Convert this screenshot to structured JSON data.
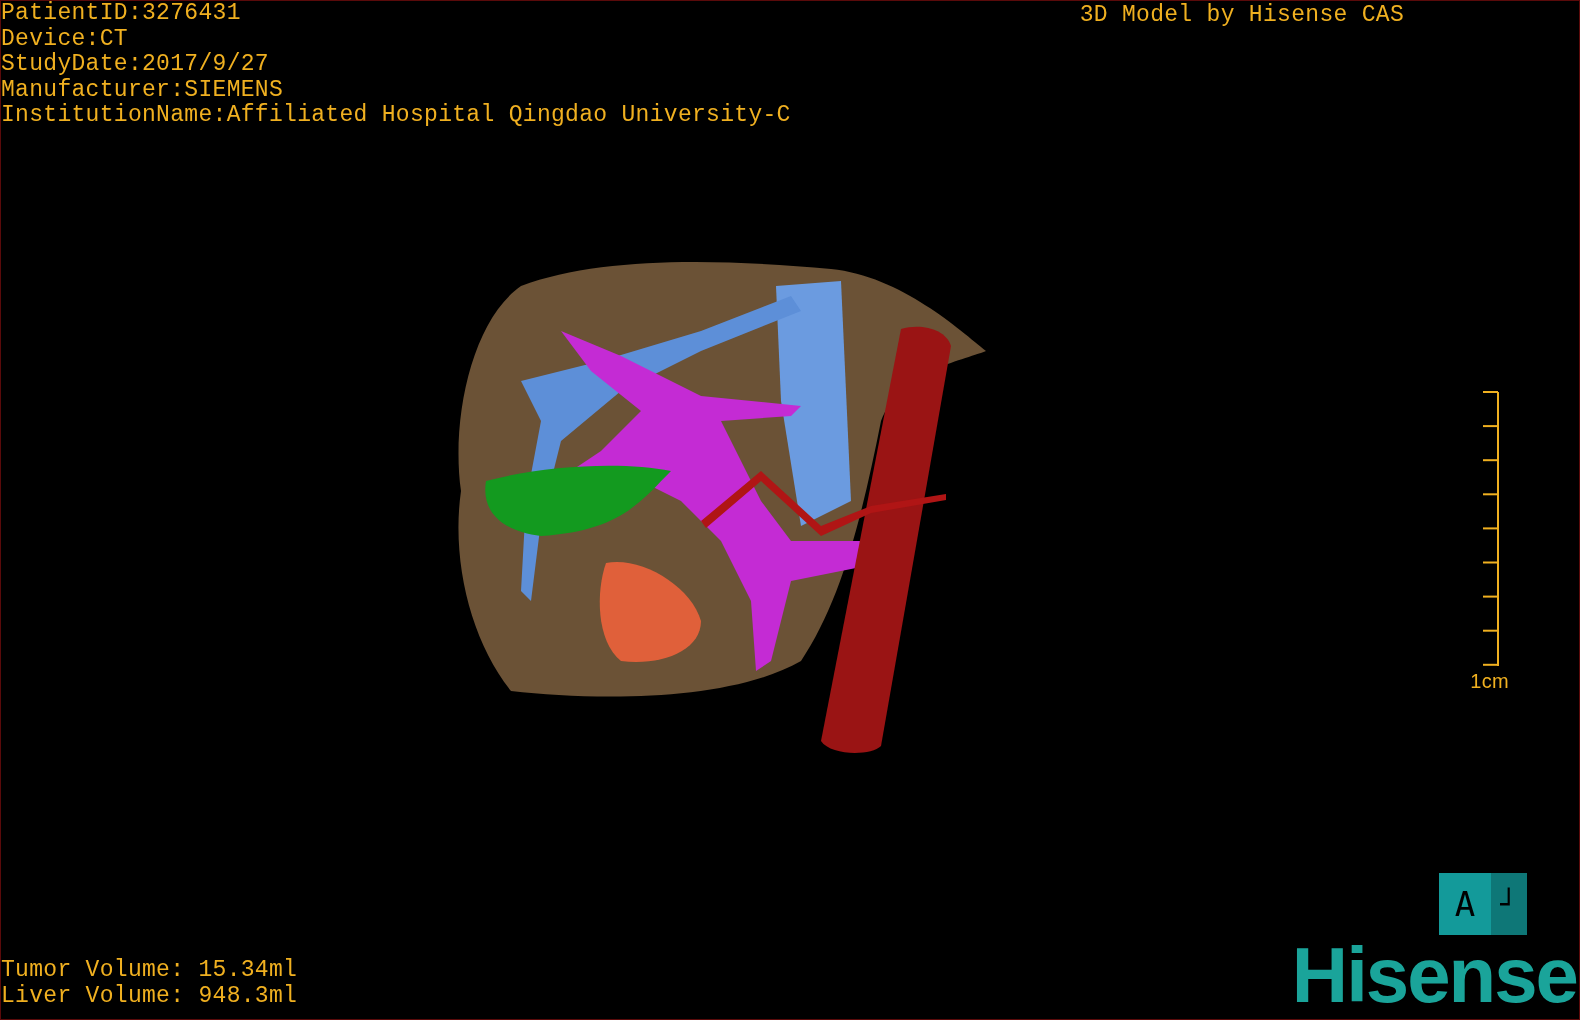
{
  "info_lines": [
    "PatientID:3276431",
    "Device:CT",
    "StudyDate:2017/9/27",
    "Manufacturer:SIEMENS",
    "InstitutionName:Affiliated Hospital Qingdao University-C"
  ],
  "title": "3D Model by Hisense CAS",
  "scale_bar": {
    "label": "1cm"
  },
  "orientation_cube": {
    "faces": [
      "A",
      "┘"
    ]
  },
  "volumes": [
    "Tumor Volume: 15.34ml",
    "Liver Volume: 948.3ml"
  ],
  "logo": "Hisense"
}
